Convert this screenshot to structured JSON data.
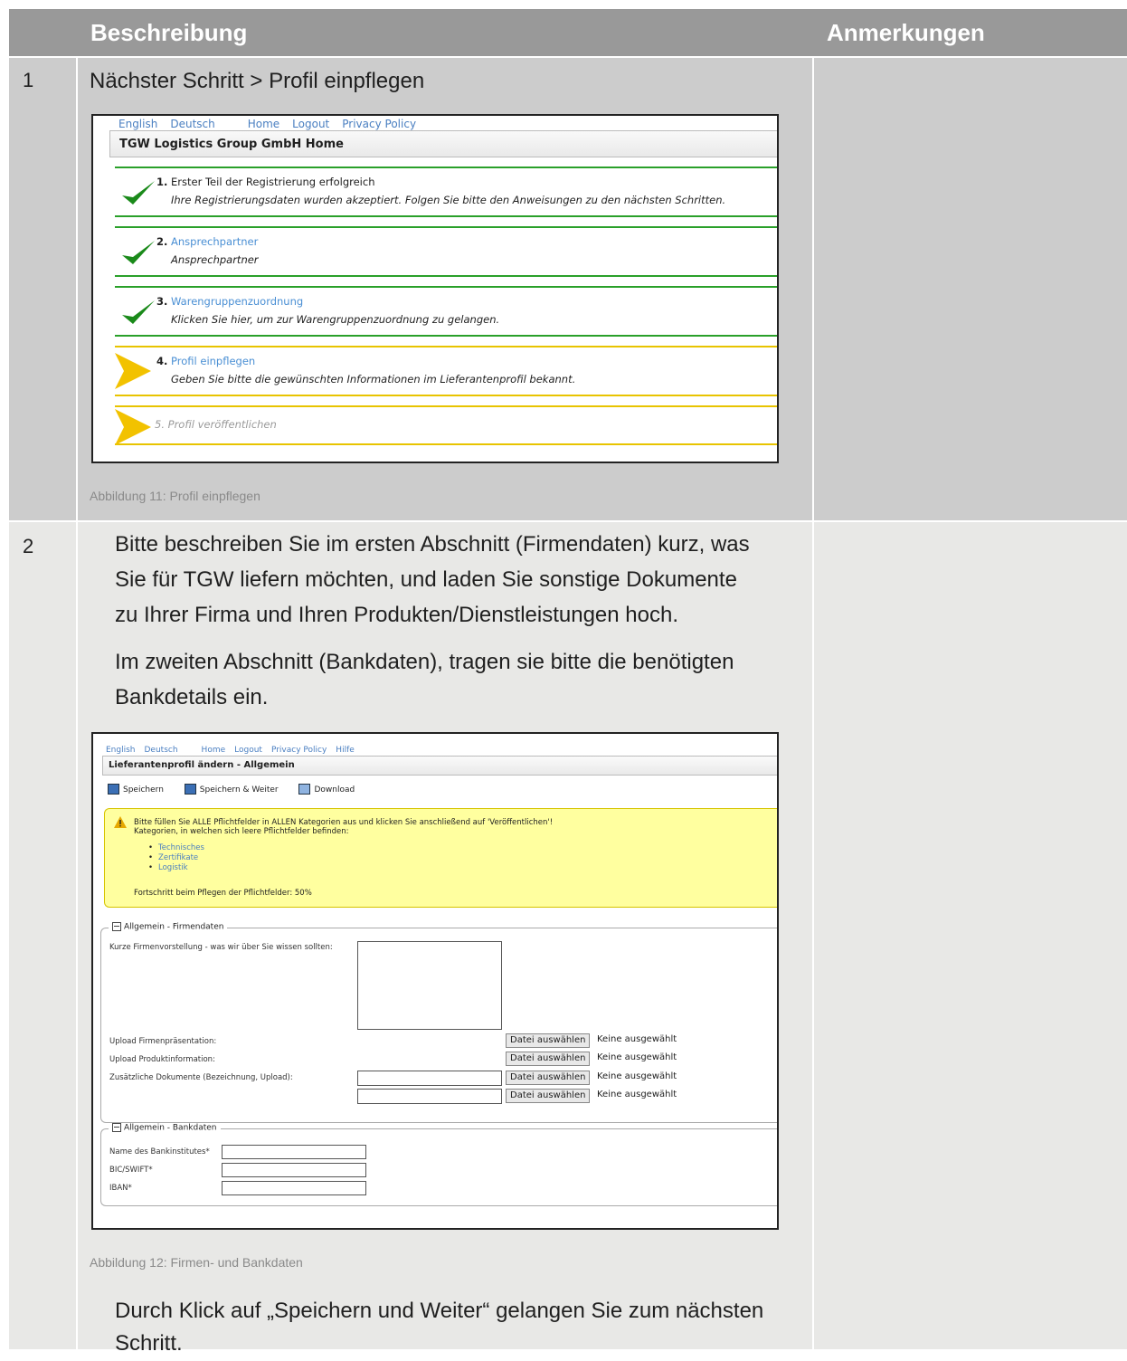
{
  "header": {
    "col_desc": "Beschreibung",
    "col_notes": "Anmerkungen"
  },
  "row1": {
    "number": "1",
    "text": "Nächster Schritt > Profil einpflegen",
    "caption": "Abbildung 11: Profil einpflegen",
    "shot": {
      "nav": [
        "English",
        "Deutsch",
        "Home",
        "Logout",
        "Privacy Policy"
      ],
      "title": "TGW Logistics Group GmbH Home",
      "steps": [
        {
          "num": "1.",
          "title": "Erster Teil der Registrierung erfolgreich",
          "desc": "Ihre Registrierungsdaten wurden akzeptiert. Folgen Sie bitte den Anweisungen zu den nächsten Schritten."
        },
        {
          "num": "2.",
          "title": "Ansprechpartner",
          "desc": "Ansprechpartner"
        },
        {
          "num": "3.",
          "title": "Warengruppenzuordnung",
          "desc": "Klicken Sie hier, um zur Warengruppenzuordnung zu gelangen."
        },
        {
          "num": "4.",
          "title": "Profil einpflegen",
          "desc": "Geben Sie bitte die gewünschten Informationen im Lieferantenprofil bekannt."
        },
        {
          "title": "5. Profil veröffentlichen"
        }
      ]
    }
  },
  "row2": {
    "number": "2",
    "para1": [
      "Bitte beschreiben Sie im ersten Abschnitt (Firmendaten) kurz, was",
      "Sie für TGW liefern möchten, und laden Sie sonstige Dokumente",
      "zu Ihrer Firma und Ihren Produkten/Dienstleistungen hoch."
    ],
    "para2": [
      "Im zweiten Abschnitt (Bankdaten), tragen sie bitte die benötigten",
      "Bankdetails ein."
    ],
    "caption": "Abbildung 12: Firmen- und Bankdaten",
    "para3": [
      "Durch Klick auf „Speichern und Weiter“ gelangen Sie zum nächsten",
      "Schritt."
    ],
    "shot": {
      "nav": [
        "English",
        "Deutsch",
        "Home",
        "Logout",
        "Privacy Policy",
        "Hilfe"
      ],
      "title": "Lieferantenprofil ändern - Allgemein",
      "toolbar": {
        "save": "Speichern",
        "save_next": "Speichern & Weiter",
        "download": "Download"
      },
      "warning": {
        "line1": "Bitte füllen Sie ALLE Pflichtfelder in ALLEN Kategorien aus und klicken Sie anschließend auf 'Veröffentlichen'!",
        "line2": "Kategorien, in welchen sich leere Pflichtfelder befinden:",
        "items": [
          "Technisches",
          "Zertifikate",
          "Logistik"
        ],
        "progress": "Fortschritt beim Pflegen der Pflichtfelder: 50%"
      },
      "firm": {
        "legend": "Allgemein - Firmendaten",
        "intro_label": "Kurze Firmenvorstellung - was wir über Sie wissen sollten:",
        "upload_presentation": "Upload Firmenpräsentation:",
        "upload_product": "Upload Produktinformation:",
        "extra_docs": "Zusätzliche Dokumente (Bezeichnung, Upload):",
        "file_button": "Datei auswählen",
        "file_none": "Keine ausgewählt"
      },
      "bank": {
        "legend": "Allgemein - Bankdaten",
        "name": "Name des Bankinstitutes*",
        "bic": "BIC/SWIFT*",
        "iban": "IBAN*"
      }
    }
  }
}
